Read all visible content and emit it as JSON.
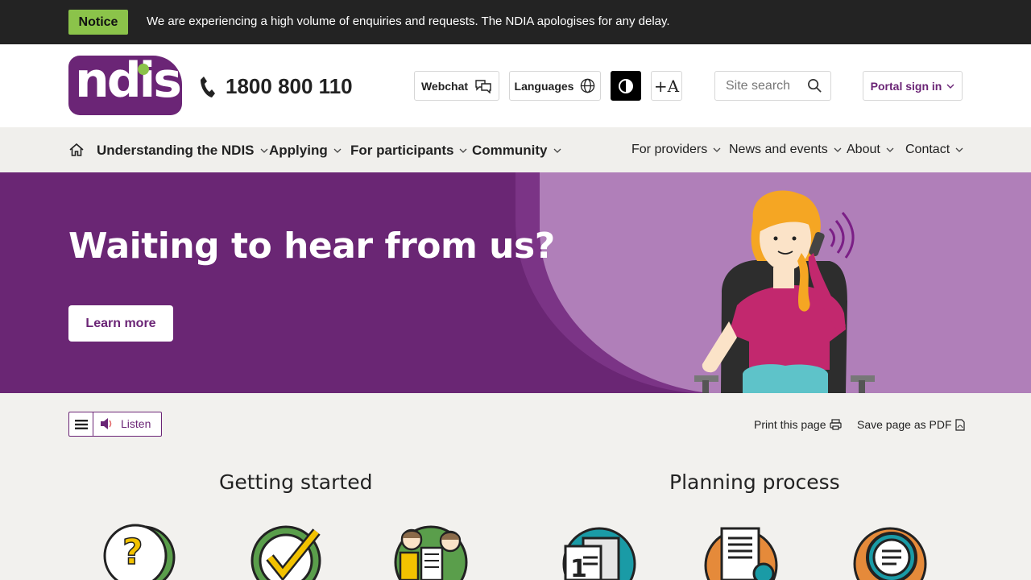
{
  "notice": {
    "badge": "Notice",
    "text": "We are experiencing a high volume of enquiries and requests. The NDIA apologises for any delay."
  },
  "header": {
    "logo_text": "ndis",
    "phone": "1800 800 110",
    "webchat_label": "Webchat",
    "languages_label": "Languages",
    "text_size_label": "+A",
    "search_placeholder": "Site search",
    "portal_label": "Portal sign in"
  },
  "nav": {
    "primary": [
      {
        "label": "Understanding the NDIS"
      },
      {
        "label": "Applying"
      },
      {
        "label": "For participants"
      },
      {
        "label": "Community"
      }
    ],
    "secondary": [
      {
        "label": "For providers"
      },
      {
        "label": "News and events"
      },
      {
        "label": "About"
      },
      {
        "label": "Contact"
      }
    ]
  },
  "hero": {
    "title": "Waiting to hear from us?",
    "button_label": "Learn more"
  },
  "toolbar": {
    "listen_label": "Listen",
    "print_label": "Print this page",
    "pdf_label": "Save page as PDF"
  },
  "sections": [
    {
      "heading": "Getting started"
    },
    {
      "heading": "Planning process"
    }
  ],
  "colors": {
    "brand_purple": "#6b2576",
    "notice_green": "#8bc34a",
    "hero_light_purple": "#b07fb9"
  }
}
